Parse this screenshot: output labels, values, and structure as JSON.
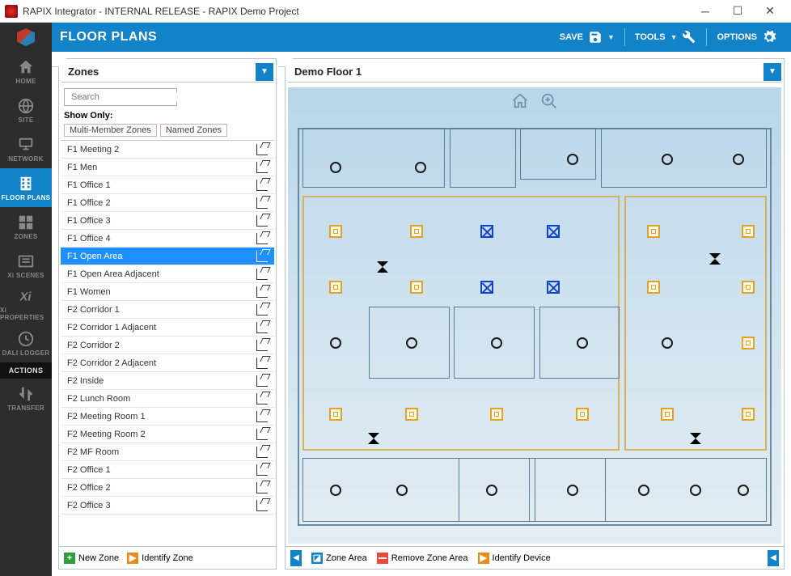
{
  "window": {
    "title": "RAPIX Integrator - INTERNAL RELEASE - RAPIX Demo Project"
  },
  "ribbon": {
    "title": "FLOOR PLANS",
    "save": "SAVE",
    "tools": "TOOLS",
    "options": "OPTIONS"
  },
  "sidebar": [
    {
      "key": "home",
      "label": "HOME"
    },
    {
      "key": "site",
      "label": "SITE"
    },
    {
      "key": "network",
      "label": "NETWORK"
    },
    {
      "key": "floorplans",
      "label": "FLOOR PLANS",
      "active": true
    },
    {
      "key": "zones",
      "label": "ZONES"
    },
    {
      "key": "xiscenes",
      "label": "Xi SCENES"
    },
    {
      "key": "xiprops",
      "label": "Xi PROPERTIES"
    },
    {
      "key": "dalilogger",
      "label": "DALI LOGGER"
    },
    {
      "key": "actions",
      "label": "ACTIONS",
      "isHeader": true
    },
    {
      "key": "transfer",
      "label": "TRANSFER"
    }
  ],
  "zonesPanel": {
    "dropdown": "Zones",
    "searchPlaceholder": "Search",
    "showOnly": "Show Only:",
    "filters": [
      "Multi-Member Zones",
      "Named Zones"
    ],
    "items": [
      {
        "n": "F1 Meeting 2"
      },
      {
        "n": "F1 Men"
      },
      {
        "n": "F1 Office 1"
      },
      {
        "n": "F1 Office 2"
      },
      {
        "n": "F1 Office 3"
      },
      {
        "n": "F1 Office 4"
      },
      {
        "n": "F1 Open Area",
        "sel": true
      },
      {
        "n": "F1 Open Area Adjacent"
      },
      {
        "n": "F1 Women"
      },
      {
        "n": "F2 Corridor 1"
      },
      {
        "n": "F2 Corridor 1 Adjacent"
      },
      {
        "n": "F2 Corridor 2"
      },
      {
        "n": "F2 Corridor 2 Adjacent"
      },
      {
        "n": "F2 Inside"
      },
      {
        "n": "F2 Lunch Room"
      },
      {
        "n": "F2 Meeting Room 1"
      },
      {
        "n": "F2 Meeting Room 2"
      },
      {
        "n": "F2 MF Room"
      },
      {
        "n": "F2 Office 1"
      },
      {
        "n": "F2 Office 2"
      },
      {
        "n": "F2 Office 3"
      }
    ],
    "newZone": "New Zone",
    "identifyZone": "Identify Zone"
  },
  "floorPanel": {
    "dropdown": "Demo Floor 1",
    "zoneArea": "Zone Area",
    "removeZoneArea": "Remove Zone Area",
    "identifyDevice": "Identify Device"
  },
  "icons": {
    "home": "home-icon",
    "site": "globe-icon",
    "network": "network-icon",
    "floorplans": "building-icon",
    "zones": "grid-icon",
    "xiscenes": "scenes-icon",
    "xiprops": "properties-icon",
    "dalilogger": "clock-icon",
    "transfer": "transfer-icon",
    "save": "save-icon",
    "tools": "wrench-icon",
    "options": "gear-icon",
    "search": "search-icon"
  },
  "colors": {
    "accent": "#1283c8",
    "sidebar": "#2d2d2d",
    "zoneBorder": "#d8b25a"
  }
}
